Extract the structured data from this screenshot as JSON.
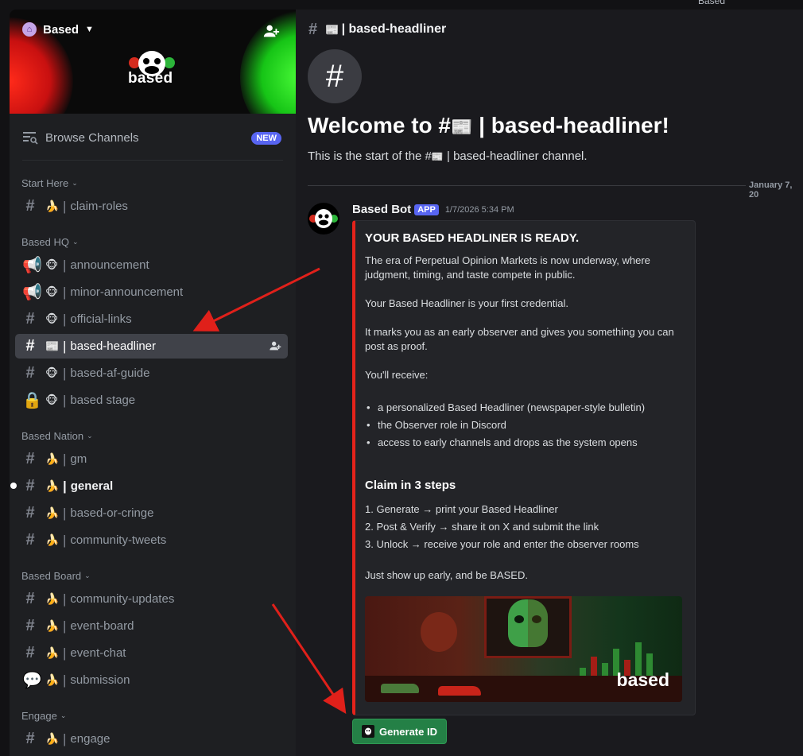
{
  "window": {
    "top_title": "Based"
  },
  "server": {
    "name": "Based",
    "banner_logo_text": "based"
  },
  "sidebar": {
    "browse_label": "Browse Channels",
    "new_badge": "NEW",
    "categories": [
      {
        "label": "Start Here"
      },
      {
        "label": "Based HQ"
      },
      {
        "label": "Based Nation"
      },
      {
        "label": "Based Board"
      },
      {
        "label": "Engage"
      }
    ],
    "channels": [
      {
        "name": "claim-roles",
        "emoji": "🍌",
        "icon": "hash-icon"
      },
      {
        "name": "announcement",
        "emoji": "🐵",
        "icon": "megaphone-icon"
      },
      {
        "name": "minor-announcement",
        "emoji": "🐵",
        "icon": "megaphone-icon"
      },
      {
        "name": "official-links",
        "emoji": "🐵",
        "icon": "hash-icon"
      },
      {
        "name": "based-headliner",
        "emoji": "📰",
        "icon": "hash-icon",
        "active": true
      },
      {
        "name": "based-af-guide",
        "emoji": "🐵",
        "icon": "hash-icon"
      },
      {
        "name": "based stage",
        "emoji": "🐵",
        "icon": "lock-icon"
      },
      {
        "name": "gm",
        "emoji": "🍌",
        "icon": "hash-icon"
      },
      {
        "name": "general",
        "emoji": "🍌",
        "icon": "hash-icon",
        "unread": true
      },
      {
        "name": "based-or-cringe",
        "emoji": "🍌",
        "icon": "hash-icon"
      },
      {
        "name": "community-tweets",
        "emoji": "🍌",
        "icon": "hash-icon"
      },
      {
        "name": "community-updates",
        "emoji": "🍌",
        "icon": "hash-icon"
      },
      {
        "name": "event-board",
        "emoji": "🍌",
        "icon": "hash-icon"
      },
      {
        "name": "event-chat",
        "emoji": "🍌",
        "icon": "hash-icon"
      },
      {
        "name": "submission",
        "emoji": "🍌",
        "icon": "forum-icon"
      },
      {
        "name": "engage",
        "emoji": "🍌",
        "icon": "hash-icon"
      }
    ]
  },
  "header": {
    "channel_emoji": "📰",
    "channel_title": "based-headliner"
  },
  "intro": {
    "welcome_prefix": "Welcome to #",
    "welcome_emoji": "📰",
    "welcome_channel": "based-headliner!",
    "subline_prefix": "This is the start of the #",
    "subline_emoji": "📰",
    "subline_suffix": "based-headliner channel.",
    "date_divider": "January 7, 20"
  },
  "message": {
    "author": "Based Bot",
    "badge": "APP",
    "timestamp": "1/7/2026 5:34 PM",
    "embed": {
      "accent_color": "#e5231b",
      "title": "YOUR BASED HEADLINER IS READY.",
      "p1": "The era of Perpetual Opinion Markets is now underway, where judgment, timing, and taste compete in public.",
      "p2": "Your Based Headliner is your first credential.",
      "p3": "It marks you as an early observer and gives you something you can post as proof.",
      "p4": "You'll receive:",
      "bullets": [
        "a personalized Based Headliner (newspaper-style bulletin)",
        "the Observer role in Discord",
        "access to early channels and drops as the system opens"
      ],
      "steps_title": "Claim in 3 steps",
      "steps": [
        "1. Generate → print your Based Headliner",
        "2. Post & Verify → share it on X and submit the link",
        "3. Unlock → receive your role and enter the observer rooms"
      ],
      "closing": "Just show up early, and be BASED.",
      "image_brand": "based"
    },
    "button_label": "Generate ID",
    "button_color": "#248046"
  }
}
